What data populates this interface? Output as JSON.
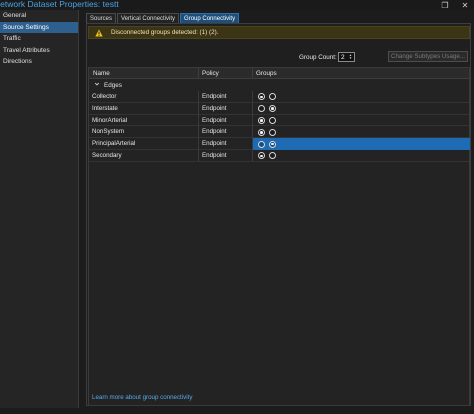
{
  "window": {
    "title": "Network Dataset Properties: testt",
    "restore_glyph": "❐",
    "close_glyph": "✕"
  },
  "sidebar": {
    "items": [
      {
        "label": "General"
      },
      {
        "label": "Source Settings"
      },
      {
        "label": "Traffic"
      },
      {
        "label": "Travel Attributes"
      },
      {
        "label": "Directions"
      }
    ],
    "active_index": 1
  },
  "tabs": [
    {
      "label": "Sources"
    },
    {
      "label": "Vertical Connectivity"
    },
    {
      "label": "Group Connectivity"
    }
  ],
  "active_tab_index": 2,
  "warning": {
    "icon": "warning-triangle-icon",
    "text": "Disconnected groups detected: (1) (2)."
  },
  "group_count": {
    "label": "Group Count:",
    "value": "2"
  },
  "change_subtypes_button": "Change Subtypes Usage...",
  "grid": {
    "headers": {
      "name": "Name",
      "policy": "Policy",
      "groups": "Groups"
    },
    "group_label": "Edges",
    "rows": [
      {
        "name": "Collector",
        "policy": "Endpoint",
        "groups": [
          true,
          false
        ],
        "selected": false
      },
      {
        "name": "Interstate",
        "policy": "Endpoint",
        "groups": [
          false,
          true
        ],
        "selected": false
      },
      {
        "name": "MinorArterial",
        "policy": "Endpoint",
        "groups": [
          true,
          false
        ],
        "selected": false
      },
      {
        "name": "NonSystem",
        "policy": "Endpoint",
        "groups": [
          true,
          false
        ],
        "selected": false
      },
      {
        "name": "PrincipalArterial",
        "policy": "Endpoint",
        "groups": [
          false,
          true
        ],
        "selected": true
      },
      {
        "name": "Secondary",
        "policy": "Endpoint",
        "groups": [
          true,
          false
        ],
        "selected": false
      }
    ]
  },
  "footer_link": "Learn more about group connectivity",
  "colors": {
    "accent": "#1e6bb3",
    "link": "#5aa9ec",
    "warning_bg": "#3b3516",
    "warning_icon": "#f0c419"
  }
}
